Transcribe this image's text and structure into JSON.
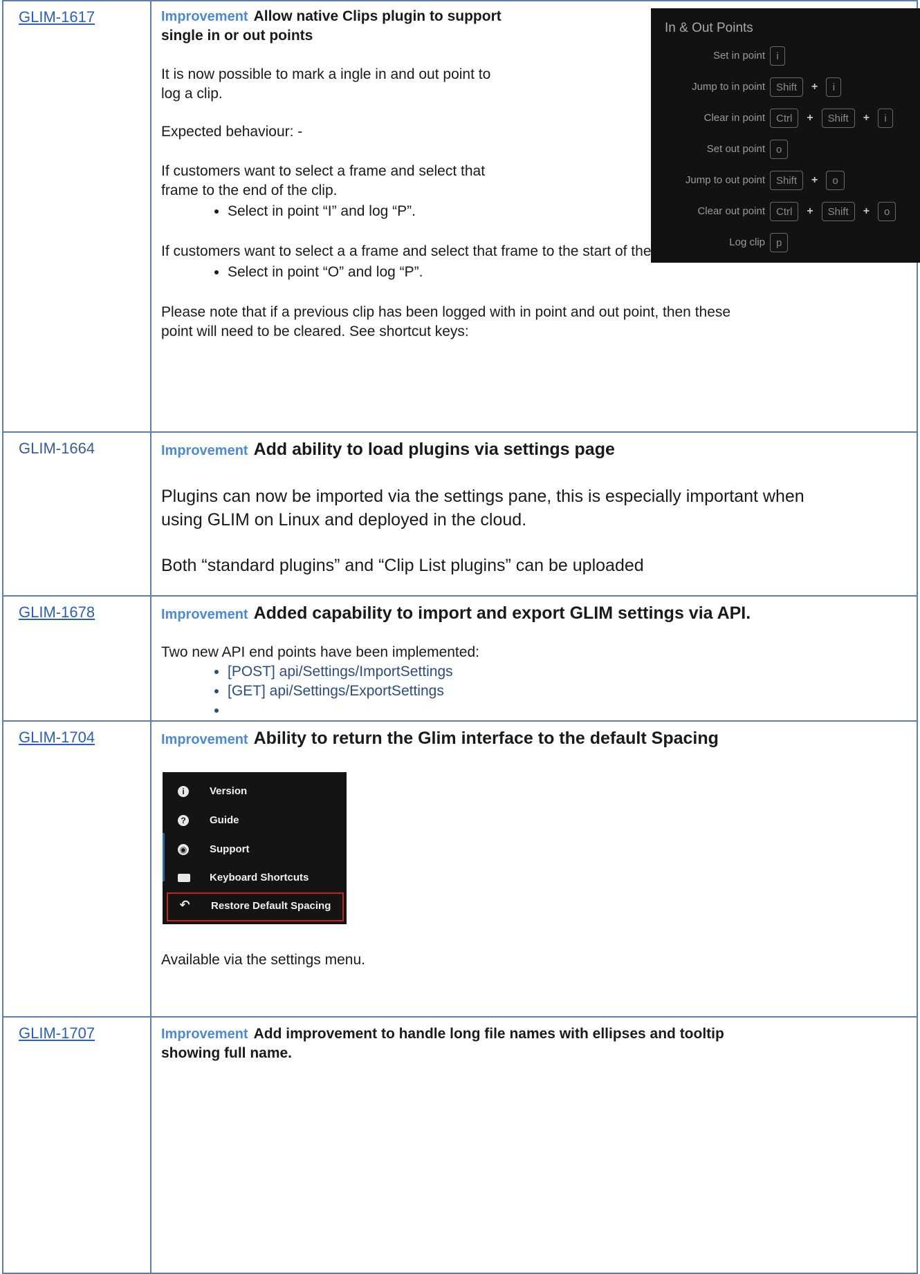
{
  "rows": [
    {
      "id": "GLIM-1617",
      "tag": "Improvement",
      "title_line1": "Allow native Clips plugin to support",
      "title_line2": "single in or out points",
      "p1_line1": "It is now possible to mark a ingle in and out point to",
      "p1_line2": "log a clip.",
      "p2": "Expected behaviour: -",
      "p3_line1": "If customers want to select a frame and select that",
      "p3_line2": "frame to the end of the clip.",
      "bullet1": "Select in point “I” and log “P”.",
      "p4": "If customers want to select a a frame and select that frame to the start of the clip.",
      "bullet2": "Select in point “O” and log “P”.",
      "p5_line1": "Please note that if a previous clip has been logged with in point and out point, then these",
      "p5_line2": "point will need to be cleared.  See shortcut keys:",
      "shortcuts": {
        "header": "In & Out Points",
        "items": [
          {
            "label": "Set in point",
            "keys": [
              "i"
            ]
          },
          {
            "label": "Jump to in point",
            "keys": [
              "Shift",
              "i"
            ]
          },
          {
            "label": "Clear in point",
            "keys": [
              "Ctrl",
              "Shift",
              "i"
            ]
          },
          {
            "label": "Set out point",
            "keys": [
              "o"
            ]
          },
          {
            "label": "Jump to out point",
            "keys": [
              "Shift",
              "o"
            ]
          },
          {
            "label": "Clear out point",
            "keys": [
              "Ctrl",
              "Shift",
              "o"
            ]
          },
          {
            "label": "Log clip",
            "keys": [
              "p"
            ]
          }
        ]
      }
    },
    {
      "id": "GLIM-1664",
      "tag": "Improvement",
      "title": "Add ability to load plugins via settings page",
      "p1_line1": "Plugins can now be imported via the settings pane, this is especially important when",
      "p1_line2": "using GLIM on Linux and deployed in the cloud.",
      "p2": "Both “standard plugins” and “Clip List plugins” can be uploaded"
    },
    {
      "id": "GLIM-1678",
      "tag": "Improvement",
      "title": "Added capability to import and export GLIM settings via API.",
      "p1": "Two new API end points have been implemented:",
      "bullet1": "[POST] api/Settings/ImportSettings",
      "bullet2": "[GET] api/Settings/ExportSettings",
      "bullet3": ""
    },
    {
      "id": "GLIM-1704",
      "tag": "Improvement",
      "title": "Ability to return the Glim interface to the default Spacing",
      "menu": {
        "items": [
          {
            "icon": "info-icon",
            "label": "Version"
          },
          {
            "icon": "help-icon",
            "label": "Guide"
          },
          {
            "icon": "support-icon",
            "label": "Support"
          },
          {
            "icon": "keyboard-icon",
            "label": "Keyboard Shortcuts"
          },
          {
            "icon": "undo-icon",
            "label": "Restore Default Spacing"
          }
        ]
      },
      "p1": "Available via the settings menu."
    },
    {
      "id": "GLIM-1707",
      "tag": "Improvement",
      "title_line1": "Add improvement to handle long file names with ellipses and tooltip",
      "title_line2": "showing full name."
    }
  ]
}
